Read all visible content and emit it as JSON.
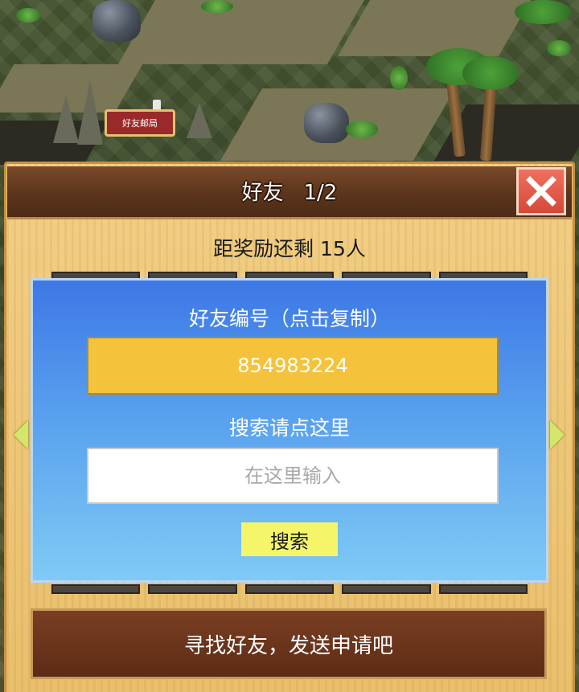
{
  "map": {
    "building_sign": "好友邮局"
  },
  "dialog": {
    "title": "好友",
    "page": "1/2",
    "reward_text": "距奖励还剩 15人",
    "friend_id_label": "好友编号（点击复制）",
    "friend_id_value": "854983224",
    "search_label": "搜索请点这里",
    "search_placeholder": "在这里输入",
    "search_button": "搜索",
    "bottom_banner": "寻找好友，发送申请吧"
  },
  "icons": {
    "close": "close-icon",
    "prev": "arrow-left-icon",
    "next": "arrow-right-icon"
  },
  "colors": {
    "title_bar": "#5c351c",
    "close_button": "#e05a48",
    "panel_top": "#3d78e6",
    "panel_bottom": "#7fcaf5",
    "friend_id_box": "#f5c23c",
    "search_button": "#f5f56a",
    "banner": "#6a3420",
    "dialog_wood": "#efc878"
  }
}
